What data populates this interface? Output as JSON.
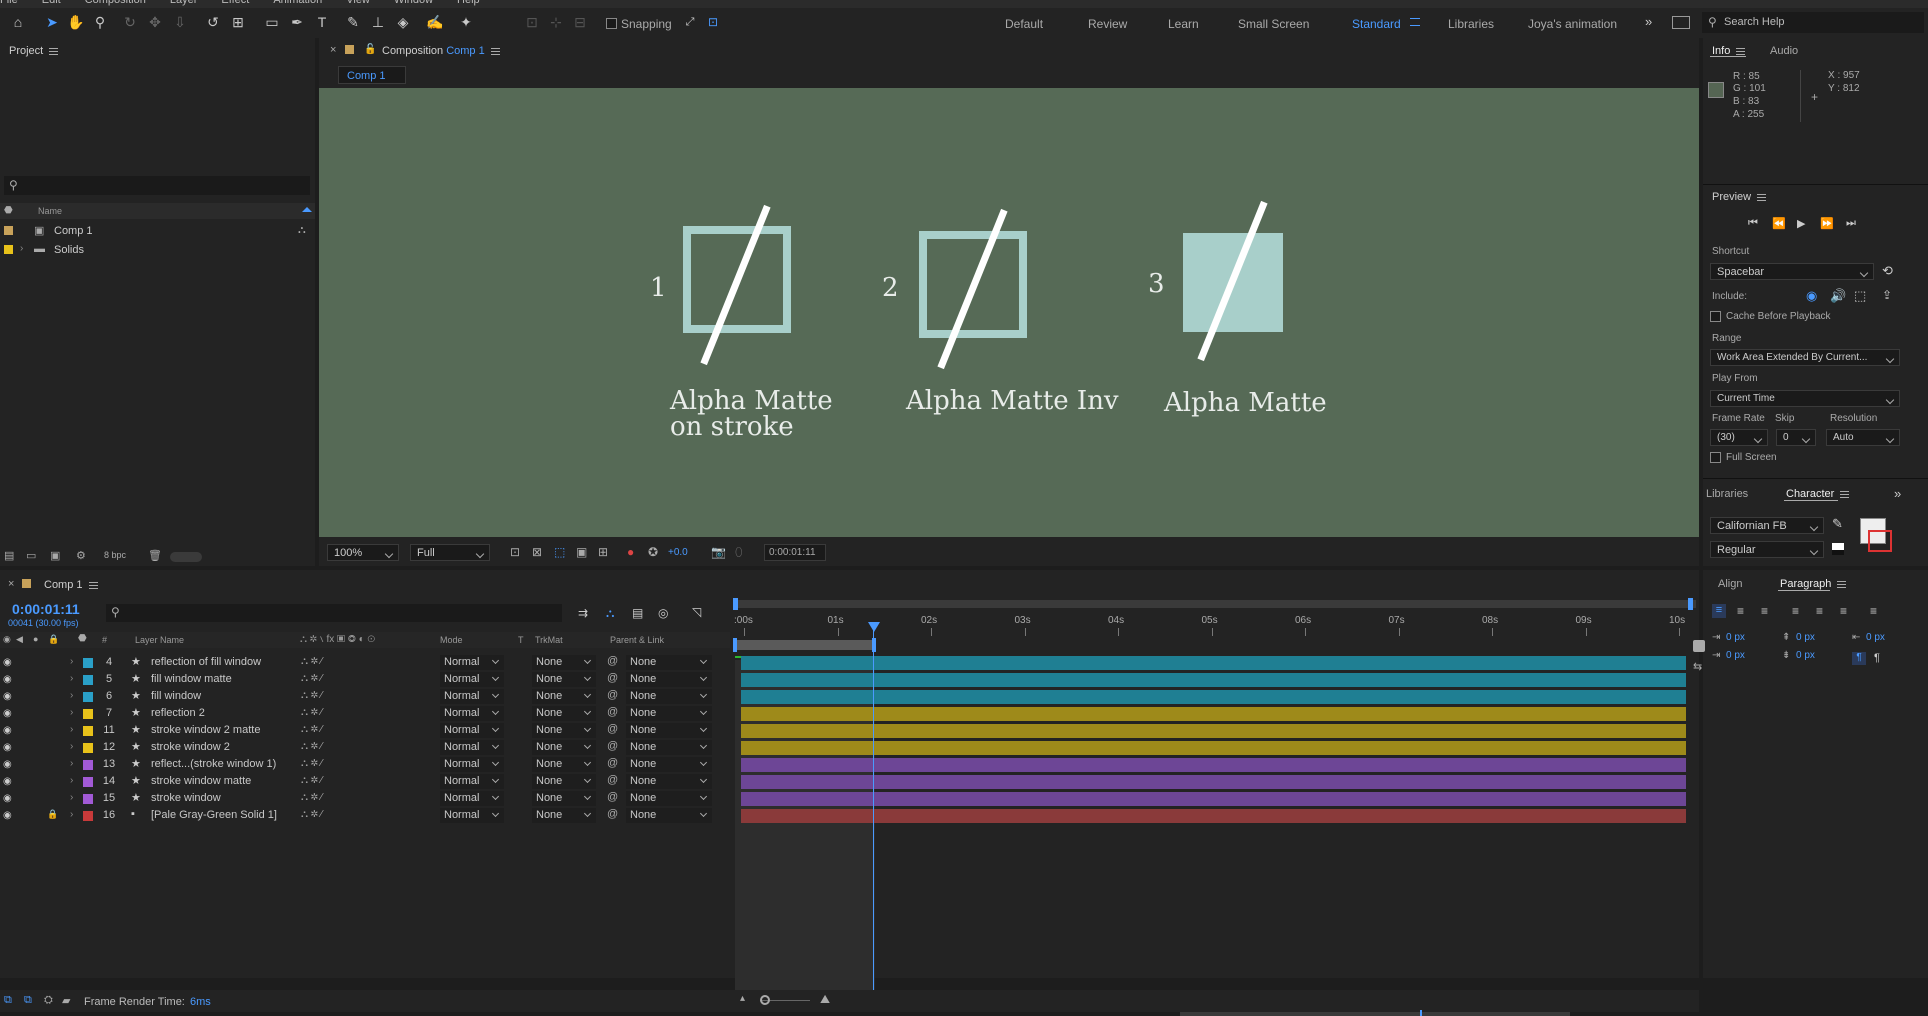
{
  "menu": [
    "File",
    "Edit",
    "Composition",
    "Layer",
    "Effect",
    "Animation",
    "View",
    "Window",
    "Help"
  ],
  "toolbar": {
    "snapping_label": "Snapping"
  },
  "workspaces": [
    "Default",
    "Review",
    "Learn",
    "Small Screen",
    "Standard",
    "Libraries",
    "Joya's animation"
  ],
  "active_workspace": "Standard",
  "search_help": "Search Help",
  "project": {
    "title": "Project",
    "col_name": "Name",
    "items": [
      {
        "name": "Comp 1",
        "color": "#c8a25a"
      },
      {
        "name": "Solids",
        "color": "#e8c21a"
      }
    ],
    "bpc": "8 bpc"
  },
  "composition": {
    "tab_prefix": "Composition",
    "tab_name": "Comp 1",
    "sub_tab": "Comp 1",
    "bg": "#566a56",
    "items": [
      {
        "num": "1",
        "caption1": "Alpha Matte",
        "caption2": "on stroke"
      },
      {
        "num": "2",
        "caption1": "Alpha Matte Inv",
        "caption2": ""
      },
      {
        "num": "3",
        "caption1": "Alpha Matte",
        "caption2": ""
      }
    ],
    "footer": {
      "zoom": "100%",
      "res": "Full",
      "exposure": "+0.0",
      "time": "0:00:01:11"
    }
  },
  "info": {
    "tab_info": "Info",
    "tab_audio": "Audio",
    "r": "R : 85",
    "g": "G : 101",
    "b": "B : 83",
    "a": "A : 255",
    "x": "X : 957",
    "y": "Y : 812"
  },
  "preview": {
    "title": "Preview",
    "shortcut_label": "Shortcut",
    "shortcut": "Spacebar",
    "include_label": "Include:",
    "cache": "Cache Before Playback",
    "range_label": "Range",
    "range": "Work Area Extended By Current...",
    "playfrom_label": "Play From",
    "playfrom": "Current Time",
    "fr_label": "Frame Rate",
    "skip_label": "Skip",
    "res_label": "Resolution",
    "fr": "(30)",
    "skip": "0",
    "res": "Auto",
    "fullscreen": "Full Screen"
  },
  "character": {
    "tab_libraries": "Libraries",
    "tab_character": "Character",
    "font": "Californian FB",
    "style": "Regular"
  },
  "paragraph": {
    "tab_align": "Align",
    "tab_paragraph": "Paragraph",
    "v1": "0 px",
    "v2": "0 px",
    "v3": "0 px",
    "v4": "0 px",
    "v5": "0 px"
  },
  "timeline": {
    "tab": "Comp 1",
    "timecode": "0:00:01:11",
    "frames": "00041 (30.00 fps)",
    "headers": {
      "layer_name": "Layer Name",
      "mode": "Mode",
      "t": "T",
      "trkmat": "TrkMat",
      "parent": "Parent & Link",
      "num": "#"
    },
    "ticks": [
      ":00s",
      "01s",
      "02s",
      "03s",
      "04s",
      "05s",
      "06s",
      "07s",
      "08s",
      "09s",
      "10s"
    ],
    "layers": [
      {
        "num": "4",
        "name": "reflection of fill window",
        "color": "#2aa0c8",
        "mode": "Normal",
        "trk": "None",
        "parent": "None",
        "bar": "#1f7f93"
      },
      {
        "num": "5",
        "name": "fill window matte",
        "color": "#2aa0c8",
        "mode": "Normal",
        "trk": "None",
        "parent": "None",
        "bar": "#1f7f93"
      },
      {
        "num": "6",
        "name": "fill window",
        "color": "#2aa0c8",
        "mode": "Normal",
        "trk": "None",
        "parent": "None",
        "bar": "#1f7f93"
      },
      {
        "num": "7",
        "name": "reflection 2",
        "color": "#e8c21a",
        "mode": "Normal",
        "trk": "None",
        "parent": "None",
        "bar": "#9e8a1a"
      },
      {
        "num": "11",
        "name": "stroke window 2 matte",
        "color": "#e8c21a",
        "mode": "Normal",
        "trk": "None",
        "parent": "None",
        "bar": "#9e8a1a"
      },
      {
        "num": "12",
        "name": "stroke window 2",
        "color": "#e8c21a",
        "mode": "Normal",
        "trk": "None",
        "parent": "None",
        "bar": "#9e8a1a"
      },
      {
        "num": "13",
        "name": "reflect...(stroke window 1)",
        "color": "#a25ad6",
        "mode": "Normal",
        "trk": "None",
        "parent": "None",
        "bar": "#6d4696"
      },
      {
        "num": "14",
        "name": "stroke window matte",
        "color": "#a25ad6",
        "mode": "Normal",
        "trk": "None",
        "parent": "None",
        "bar": "#6d4696"
      },
      {
        "num": "15",
        "name": "stroke window",
        "color": "#a25ad6",
        "mode": "Normal",
        "trk": "None",
        "parent": "None",
        "bar": "#6d4696"
      },
      {
        "num": "16",
        "name": "[Pale Gray-Green Solid 1]",
        "color": "#c83a3a",
        "mode": "Normal",
        "trk": "None",
        "parent": "None",
        "bar": "#8a3a3a"
      }
    ],
    "render_label": "Frame Render Time:",
    "render_value": "6ms"
  }
}
